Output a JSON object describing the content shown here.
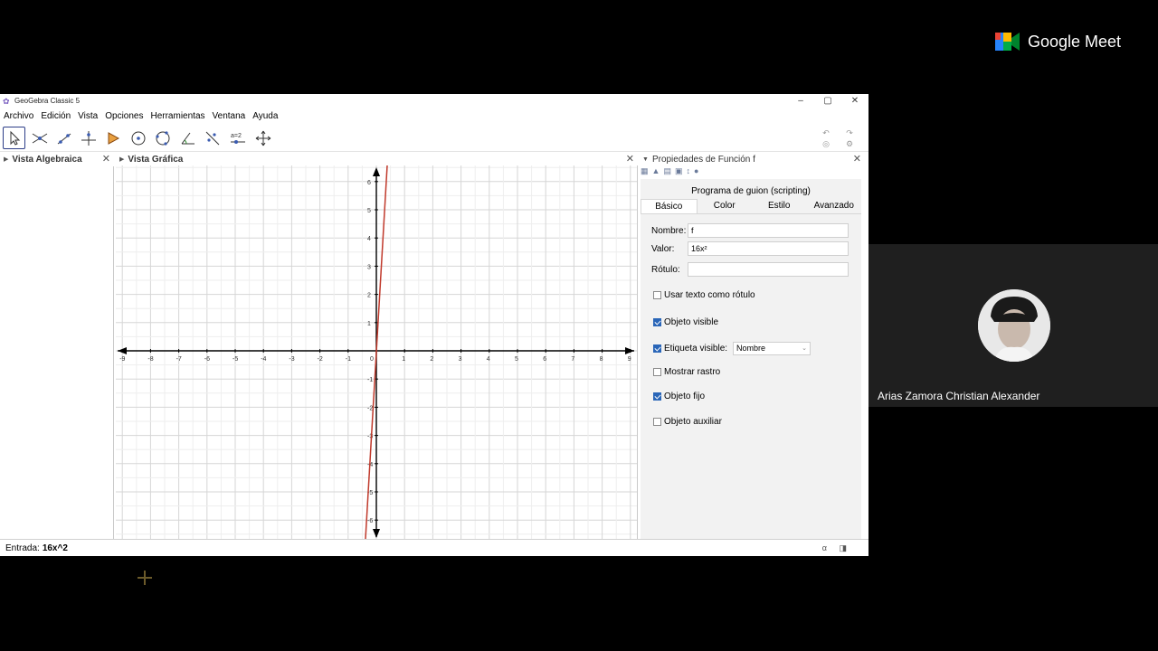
{
  "window": {
    "title": "GeoGebra Classic 5",
    "controls": [
      "–",
      "▢",
      "✕"
    ]
  },
  "menu": [
    "Archivo",
    "Edición",
    "Vista",
    "Opciones",
    "Herramientas",
    "Ventana",
    "Ayuda"
  ],
  "toolbar": {
    "tools": [
      "move-tool",
      "point-tool",
      "line-tool",
      "perpendicular-tool",
      "polygon-tool",
      "circle-center-tool",
      "circle-three-points-tool",
      "angle-tool",
      "reflect-tool",
      "slider-tool",
      "move-graphics-tool"
    ],
    "slider_label": "a=2"
  },
  "algebra_view": {
    "title": "Vista Algebraica"
  },
  "graphics_view": {
    "title": "Vista Gráfica",
    "x_ticks": [
      "-9",
      "-8",
      "-7",
      "-6",
      "-5",
      "-4",
      "-3",
      "-2",
      "-1",
      "0",
      "1",
      "2",
      "3",
      "4",
      "5",
      "6",
      "7",
      "8",
      "9"
    ],
    "y_ticks": [
      "6",
      "5",
      "4",
      "3",
      "2",
      "1",
      "-1",
      "-2",
      "-3",
      "-4",
      "-5",
      "-6"
    ],
    "curve_color": "#c0392b"
  },
  "properties": {
    "title": "Propiedades de Función f",
    "script_tab": "Programa de guion (scripting)",
    "tabs": [
      "Básico",
      "Color",
      "Estilo",
      "Avanzado"
    ],
    "name_label": "Nombre:",
    "name_value": "f",
    "value_label": "Valor:",
    "value_value": "16x²",
    "caption_label": "Rótulo:",
    "caption_value": "",
    "use_text_caption": "Usar texto como rótulo",
    "show_object": "Objeto visible",
    "show_label": "Etiqueta visible:",
    "label_option": "Nombre",
    "show_trace": "Mostrar rastro",
    "fix_object": "Objeto fijo",
    "auxiliary": "Objeto auxiliar"
  },
  "input_bar": {
    "label": "Entrada:",
    "value": "16x^2",
    "alpha": "α"
  },
  "meet": {
    "brand": "Google Meet",
    "participant": "Arias Zamora Christian Alexander"
  },
  "colors": {
    "accent": "#2a66b8",
    "curve": "#c0392b",
    "tile_bg": "#1f1f1f"
  }
}
